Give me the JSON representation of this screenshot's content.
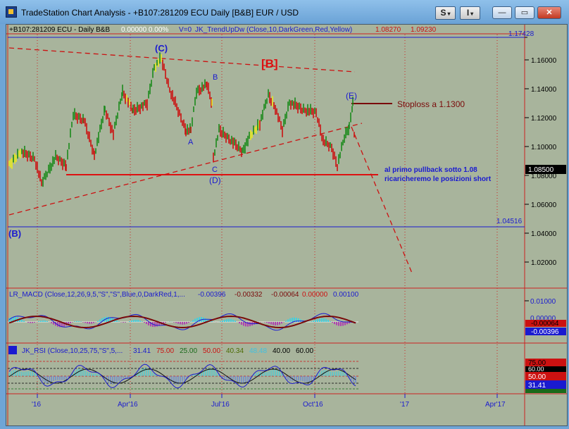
{
  "window": {
    "title": "TradeStation Chart Analysis - +B107:281209 ECU Daily [B&B] EUR / USD",
    "btn_s": "S",
    "btn_i": "I",
    "dropdown": "▾",
    "minimize": "—",
    "restore": "▭",
    "close": "✕"
  },
  "header": {
    "symbol": "+B107:281209 ECU - Daily  B&B",
    "vals": "0.00000  0.00%",
    "vzero": "V=0",
    "indicator": "JK_TrendUpDw (Close,10,DarkGreen,Red,Yellow)",
    "v1": "1.08270",
    "v2": "1.09230"
  },
  "price_axis": {
    "ticks": [
      "1.16000",
      "1.14000",
      "1.12000",
      "1.10000",
      "1.08000",
      "1.06000",
      "1.04000",
      "1.02000"
    ],
    "top_label": "1.17428",
    "last_price": "1.08500",
    "support_label": "1.04516"
  },
  "annotations": {
    "wave_c_top": "(C)",
    "wave_b_big": "[B]",
    "b_small": "B",
    "a_small": "A",
    "c_small": "C",
    "d_wave": "(D)",
    "e_wave": "(E)",
    "b_wave": "(B)",
    "stoploss": "Stoploss a 1.1300",
    "note1": "al primo pullback sotto 1.08",
    "note2": "ricaricheremo le posizioni short"
  },
  "macd": {
    "label": "LR_MACD (Close,12,26,9,5,\"S\",\"S\",Blue,0,DarkRed,1,...",
    "v1": "-0.00396",
    "v2": "-0.00332",
    "v3": "-0.00064",
    "v4": "0.00000",
    "v5": "0.00100",
    "tick_top": "0.01000",
    "tick_mid": "0.00000",
    "badge1": "-0.00064",
    "badge2": "-0.00396"
  },
  "rsi": {
    "label": "JK_RSI (Close,10,25,75,\"S\",5,...",
    "v1": "31.41",
    "v2": "75.00",
    "v3": "25.00",
    "v4": "50.00",
    "v5": "40.34",
    "v6": "48.48",
    "v7": "40.00",
    "v8": "60.00",
    "badge75": "75.00",
    "badge60": "60.00",
    "badge50": "50.00",
    "badge31": "31.41",
    "badge40": "40.00",
    "badge25": "25.00"
  },
  "time_axis": [
    "'16",
    "Apr'16",
    "Jul'16",
    "Oct'16",
    "'17",
    "Apr'17"
  ],
  "colors": {
    "chart_bg": "#a8b49c",
    "bull": "#1a8a1a",
    "bear": "#cc1111",
    "neutral": "#e8e820",
    "wave_label": "#1a1ad0"
  }
}
